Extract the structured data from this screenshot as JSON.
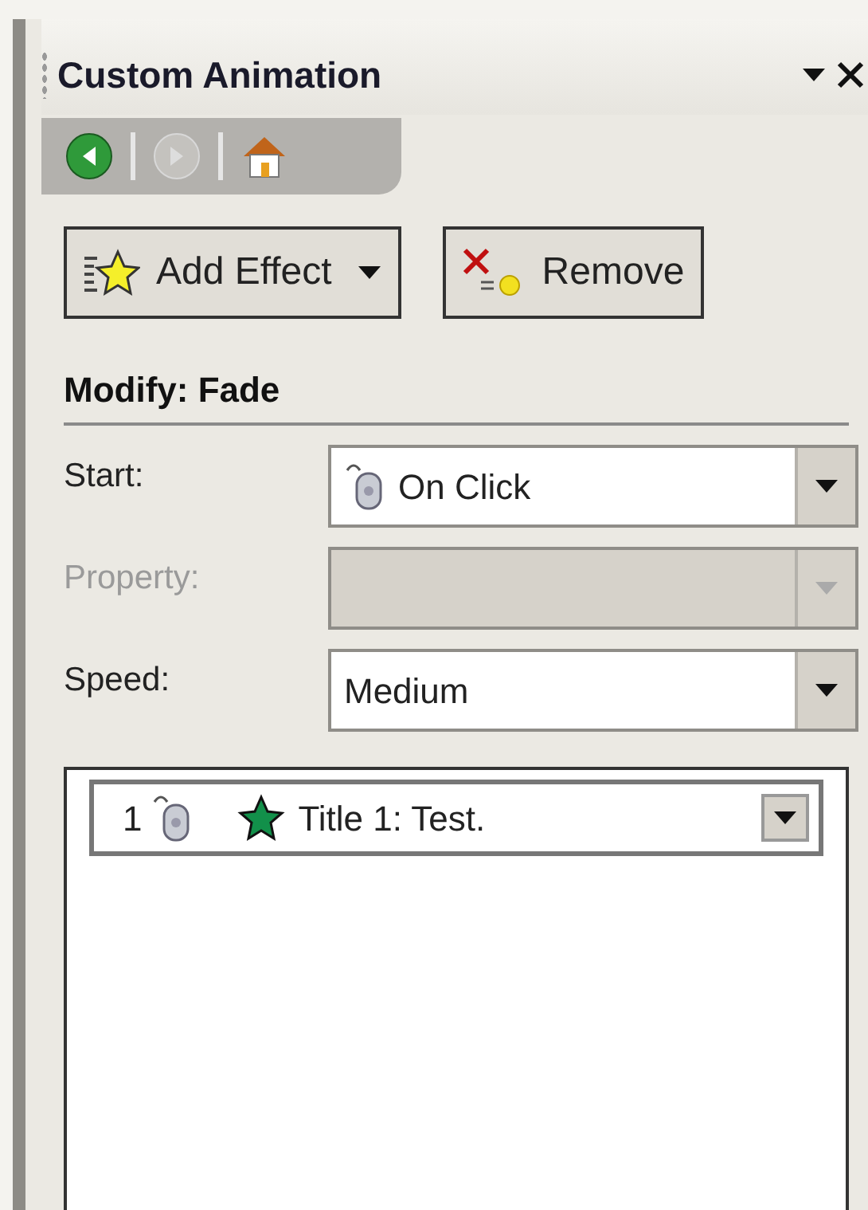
{
  "pane": {
    "title": "Custom Animation"
  },
  "nav": [
    {
      "kind": "back",
      "disabled": false
    },
    {
      "kind": "forward",
      "disabled": true
    },
    {
      "kind": "home",
      "disabled": false
    }
  ],
  "buttons": [
    {
      "kind": "add",
      "label": "Add Effect",
      "dropdown": true
    },
    {
      "kind": "remove",
      "label": "Remove",
      "dropdown": false
    }
  ],
  "section": "Modify: Fade",
  "fields": [
    {
      "label": "Start:",
      "value": "On Click",
      "kind": "mouse",
      "disabled": false
    },
    {
      "label": "Property:",
      "kind": "plain",
      "disabled": true
    },
    {
      "label": "Speed:",
      "value": "Medium",
      "kind": "plain",
      "disabled": false
    }
  ],
  "effects": [
    {
      "number": "1",
      "text": "Title 1: Test."
    }
  ]
}
